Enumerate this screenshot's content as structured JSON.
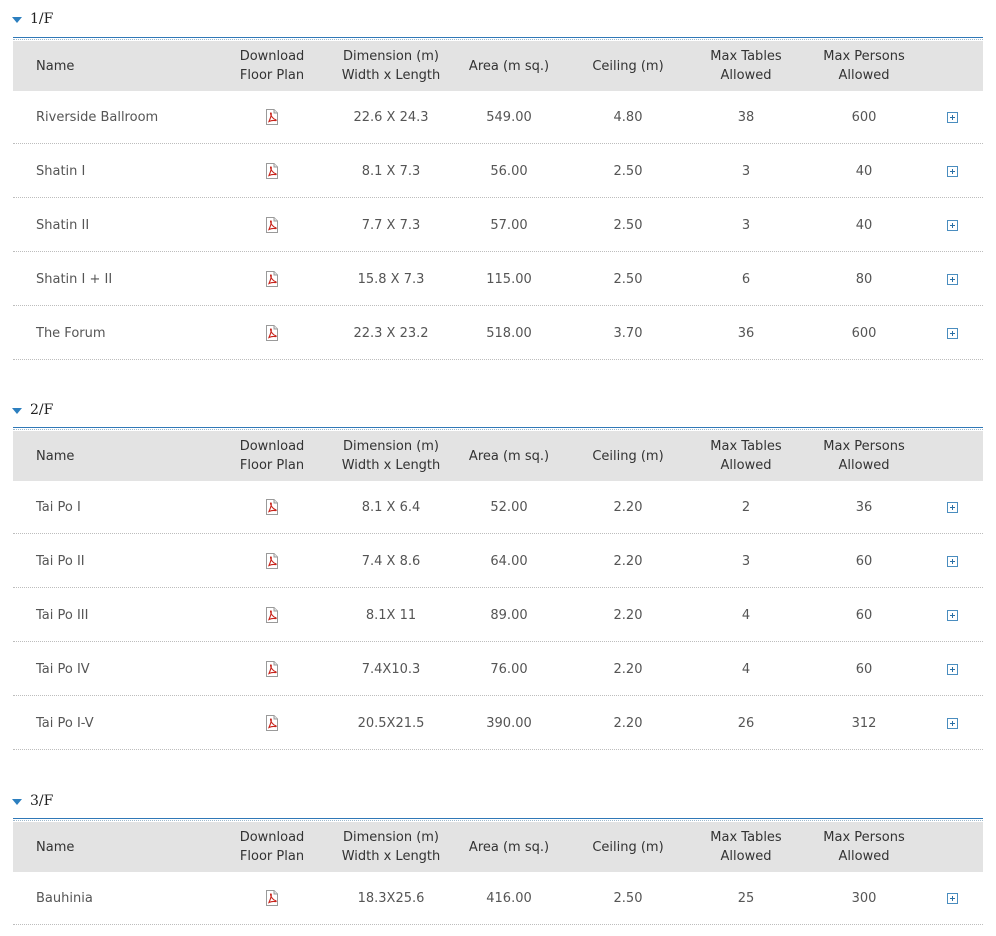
{
  "headers": {
    "name": "Name",
    "download_l1": "Download",
    "download_l2": "Floor Plan",
    "dimension_l1": "Dimension (m)",
    "dimension_l2": "Width x Length",
    "area": "Area (m sq.)",
    "ceiling": "Ceiling (m)",
    "tables_l1": "Max Tables",
    "tables_l2": "Allowed",
    "persons_l1": "Max Persons",
    "persons_l2": "Allowed"
  },
  "sections": [
    {
      "floor": "1/F",
      "rows": [
        {
          "name": "Riverside Ballroom",
          "dimension": "22.6 X 24.3",
          "area": "549.00",
          "ceiling": "4.80",
          "tables": "38",
          "persons": "600"
        },
        {
          "name": "Shatin I",
          "dimension": "8.1 X 7.3",
          "area": "56.00",
          "ceiling": "2.50",
          "tables": "3",
          "persons": "40"
        },
        {
          "name": "Shatin II",
          "dimension": "7.7 X 7.3",
          "area": "57.00",
          "ceiling": "2.50",
          "tables": "3",
          "persons": "40"
        },
        {
          "name": "Shatin I + II",
          "dimension": "15.8 X 7.3",
          "area": "115.00",
          "ceiling": "2.50",
          "tables": "6",
          "persons": "80"
        },
        {
          "name": "The Forum",
          "dimension": "22.3 X 23.2",
          "area": "518.00",
          "ceiling": "3.70",
          "tables": "36",
          "persons": "600"
        }
      ]
    },
    {
      "floor": "2/F",
      "rows": [
        {
          "name": "Tai Po I",
          "dimension": "8.1 X 6.4",
          "area": "52.00",
          "ceiling": "2.20",
          "tables": "2",
          "persons": "36"
        },
        {
          "name": "Tai Po II",
          "dimension": "7.4 X 8.6",
          "area": "64.00",
          "ceiling": "2.20",
          "tables": "3",
          "persons": "60"
        },
        {
          "name": "Tai Po III",
          "dimension": "8.1X 11",
          "area": "89.00",
          "ceiling": "2.20",
          "tables": "4",
          "persons": "60"
        },
        {
          "name": "Tai Po IV",
          "dimension": "7.4X10.3",
          "area": "76.00",
          "ceiling": "2.20",
          "tables": "4",
          "persons": "60"
        },
        {
          "name": "Tai Po I-V",
          "dimension": "20.5X21.5",
          "area": "390.00",
          "ceiling": "2.20",
          "tables": "26",
          "persons": "312"
        }
      ]
    },
    {
      "floor": "3/F",
      "rows": [
        {
          "name": "Bauhinia",
          "dimension": "18.3X25.6",
          "area": "416.00",
          "ceiling": "2.50",
          "tables": "25",
          "persons": "300"
        }
      ]
    }
  ],
  "icons": {
    "download": "pdf-file-icon",
    "expand": "plus-square-icon"
  },
  "colors": {
    "accent": "#2f78b7",
    "header_bg": "#e3e3e3",
    "pdf_red": "#c8231b"
  }
}
